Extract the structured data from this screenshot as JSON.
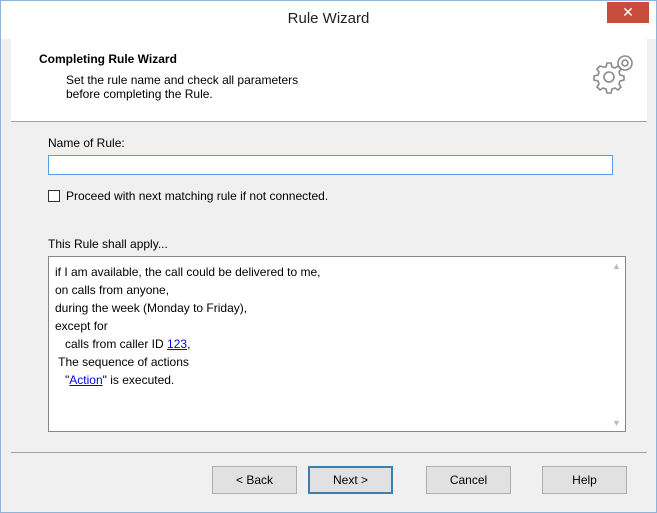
{
  "window": {
    "title": "Rule Wizard",
    "close_label": "✕"
  },
  "header": {
    "title": "Completing Rule Wizard",
    "description": "Set the rule name and check all parameters\nbefore completing the Rule."
  },
  "form": {
    "name_label": "Name of Rule:",
    "name_value": "",
    "proceed_label": "Proceed with next matching rule if not connected.",
    "proceed_checked": false,
    "apply_label": "This Rule shall apply..."
  },
  "apply_text": {
    "line1": "if I am available, the call could be delivered to me,",
    "line2": "on calls from anyone,",
    "line3": "during the week (Monday to Friday),",
    "line4": "except for",
    "line5_prefix": "   calls from caller ID ",
    "line5_link": "123",
    "line5_suffix": ",",
    "line6": " The sequence of actions",
    "line7_prefix": "   \"",
    "line7_link": "Action",
    "line7_suffix": "\" is executed."
  },
  "buttons": {
    "back": "< Back",
    "next": "Next >",
    "cancel": "Cancel",
    "help": "Help"
  },
  "icons": {
    "header_icon": "gears-icon",
    "close": "close-icon",
    "scroll_up": "chevron-up-icon",
    "scroll_down": "chevron-down-icon"
  },
  "colors": {
    "close_button": "#c74c3c",
    "link": "#0000ee",
    "input_focus_border": "#569de5"
  }
}
